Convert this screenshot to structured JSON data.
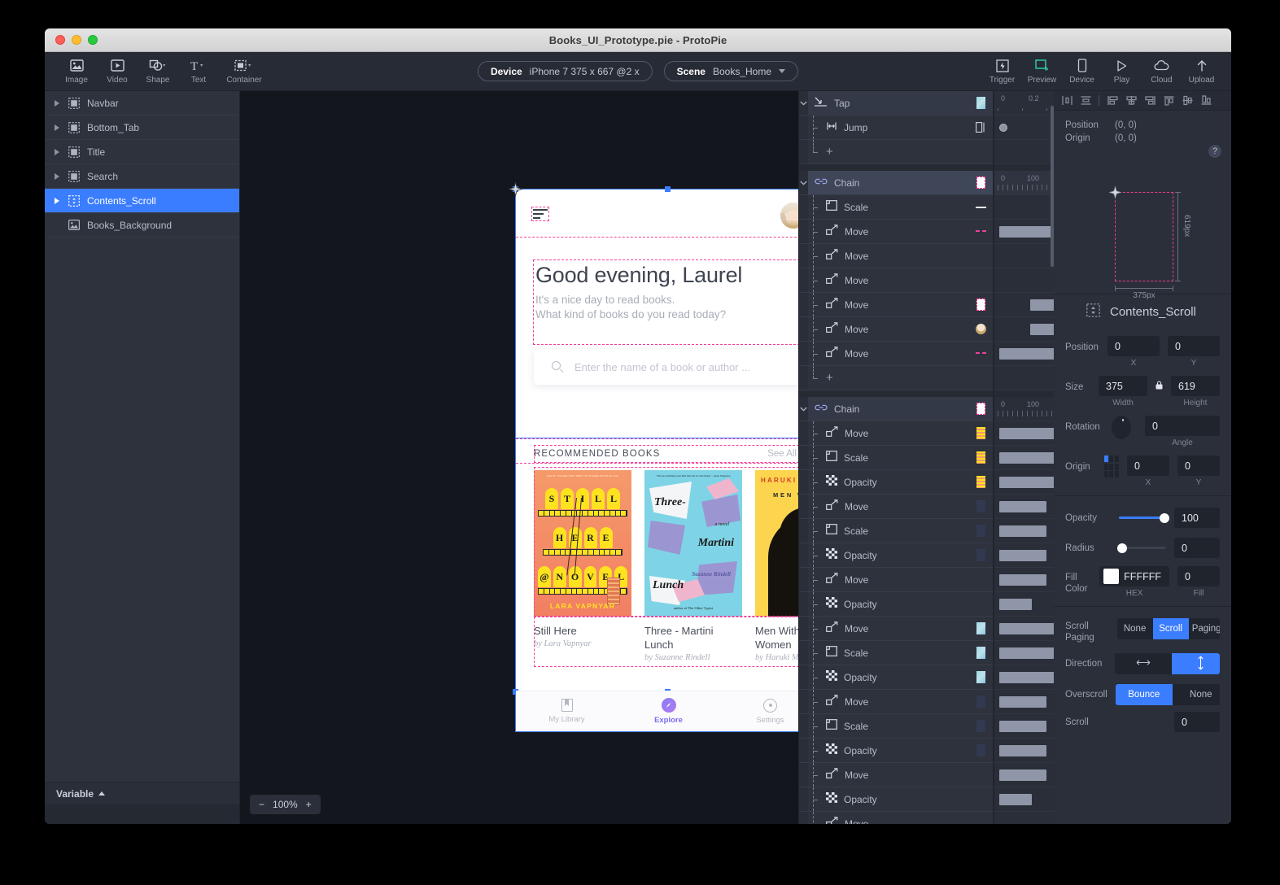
{
  "window": {
    "title": "Books_UI_Prototype.pie - ProtoPie"
  },
  "toolbar": {
    "left_tools": [
      {
        "label": "Image",
        "icon": "image-icon",
        "has_caret": false
      },
      {
        "label": "Video",
        "icon": "video-icon",
        "has_caret": false
      },
      {
        "label": "Shape",
        "icon": "shape-icon",
        "has_caret": true
      },
      {
        "label": "Text",
        "icon": "text-icon",
        "has_caret": true
      },
      {
        "label": "Container",
        "icon": "container-icon",
        "has_caret": true
      }
    ],
    "device": {
      "key": "Device",
      "value": "iPhone 7  375 x 667  @2 x"
    },
    "scene": {
      "key": "Scene",
      "value": "Books_Home"
    },
    "right_tools": [
      {
        "label": "Trigger",
        "icon": "trigger-icon"
      },
      {
        "label": "Preview",
        "icon": "preview-icon"
      },
      {
        "label": "Device",
        "icon": "device-icon"
      },
      {
        "label": "Play",
        "icon": "play-icon"
      },
      {
        "label": "Cloud",
        "icon": "cloud-icon"
      },
      {
        "label": "Upload",
        "icon": "upload-icon"
      }
    ]
  },
  "layers": {
    "items": [
      {
        "name": "Navbar",
        "icon": "container-icon",
        "selected": false,
        "expandable": true
      },
      {
        "name": "Bottom_Tab",
        "icon": "container-icon",
        "selected": false,
        "expandable": true
      },
      {
        "name": "Title",
        "icon": "container-icon",
        "selected": false,
        "expandable": true
      },
      {
        "name": "Search",
        "icon": "container-icon",
        "selected": false,
        "expandable": true
      },
      {
        "name": "Contents_Scroll",
        "icon": "scroll-container-icon",
        "selected": true,
        "expandable": true
      },
      {
        "name": "Books_Background",
        "icon": "image-icon",
        "selected": false,
        "expandable": false
      }
    ],
    "variable_label": "Variable"
  },
  "canvas": {
    "zoom_level": "100%",
    "zoom_out": "−",
    "zoom_in": "+",
    "phone": {
      "greeting": "Good evening, Laurel",
      "subtitle_line1": "It's a nice day to read books.",
      "subtitle_line2": "What kind of books do you read today?",
      "search_placeholder": "Enter the name of a book or author ...",
      "section_title": "RECOMMENDED BOOKS",
      "see_all": "See All",
      "books": [
        {
          "title": "Still Here",
          "author": "by Lara Vapnyar",
          "cover_top_text": "ONE OF THE NEW YORK TIMES 100 NOTABLE BOOKS OF 2016",
          "cover_words": [
            "S",
            "T",
            "I",
            "L",
            "L",
            "H",
            "E",
            "R",
            "E",
            "@",
            "N",
            "O",
            "V",
            "E",
            "L"
          ],
          "cover_author": "LARA VAPNYAR"
        },
        {
          "title": "Three - Martini Lunch",
          "author": "by Suzanne Rindell",
          "cover_blurb": "\"Here he publishing what Mad Men did for advertising.\" - James Magnuson",
          "cover_t1": "Three-",
          "cover_t2": "a novel",
          "cover_t3": "Martini",
          "cover_t4": "Lunch",
          "cover_t5": "Suzanne Rindell",
          "cover_t6": "author of The Other Typist"
        },
        {
          "title": "Men Without Women",
          "author": "by Haruki Mura",
          "cover_t1": "HARUKI MUR",
          "cover_t2": "MEN W"
        }
      ],
      "tabs": [
        {
          "label": "My Library",
          "icon": "bookmark-icon",
          "active": false
        },
        {
          "label": "Explore",
          "icon": "compass-icon",
          "active": true
        },
        {
          "label": "Settings",
          "icon": "gear-icon",
          "active": false
        }
      ]
    }
  },
  "timeline": {
    "groups": [
      {
        "name": "Tap",
        "icon": "tap-icon",
        "thumb": "photo",
        "selected": false,
        "ruler": {
          "start": "0",
          "mid": "0.2"
        },
        "rows": [
          {
            "name": "Jump",
            "icon": "jump-icon",
            "thumb": "jump-thumb",
            "track": "keyframe"
          },
          {
            "name": "+",
            "icon": "plus-icon",
            "thumb": "",
            "track": ""
          }
        ]
      },
      {
        "name": "Chain",
        "icon": "chain-icon",
        "thumb": "dash",
        "selected": true,
        "ruler": {
          "start": "0",
          "mid": "100"
        },
        "rows": [
          {
            "name": "Scale",
            "icon": "scale-icon",
            "thumb": "line",
            "track": ""
          },
          {
            "name": "Move",
            "icon": "move-icon",
            "thumb": "pinkline",
            "track": "bar-long"
          },
          {
            "name": "Move",
            "icon": "move-icon",
            "thumb": "empty",
            "track": ""
          },
          {
            "name": "Move",
            "icon": "move-icon",
            "thumb": "empty",
            "track": ""
          },
          {
            "name": "Move",
            "icon": "move-icon",
            "thumb": "dash",
            "track": "bar-short"
          },
          {
            "name": "Move",
            "icon": "move-icon",
            "thumb": "face",
            "track": "bar-short"
          },
          {
            "name": "Move",
            "icon": "move-icon",
            "thumb": "pinkline",
            "track": "bar-long"
          },
          {
            "name": "+",
            "icon": "plus-icon",
            "thumb": "",
            "track": ""
          }
        ]
      },
      {
        "name": "Chain",
        "icon": "chain-icon",
        "thumb": "dash",
        "selected": false,
        "ruler": {
          "start": "0",
          "mid": "100"
        },
        "rows": [
          {
            "name": "Move",
            "icon": "move-icon",
            "thumb": "book1",
            "track": "bar-long"
          },
          {
            "name": "Scale",
            "icon": "scale-icon",
            "thumb": "book1",
            "track": "bar-long"
          },
          {
            "name": "Opacity",
            "icon": "opacity-icon",
            "thumb": "book1",
            "track": "bar-long"
          },
          {
            "name": "Move",
            "icon": "move-icon",
            "thumb": "bluebox",
            "track": "bar-med"
          },
          {
            "name": "Scale",
            "icon": "scale-icon",
            "thumb": "bluebox",
            "track": "bar-med"
          },
          {
            "name": "Opacity",
            "icon": "opacity-icon",
            "thumb": "bluebox",
            "track": "bar-med"
          },
          {
            "name": "Move",
            "icon": "move-icon",
            "thumb": "empty",
            "track": "bar-med"
          },
          {
            "name": "Opacity",
            "icon": "opacity-icon",
            "thumb": "empty",
            "track": "bar-sm"
          },
          {
            "name": "Move",
            "icon": "move-icon",
            "thumb": "photo",
            "track": "bar-long"
          },
          {
            "name": "Scale",
            "icon": "scale-icon",
            "thumb": "photo",
            "track": "bar-long"
          },
          {
            "name": "Opacity",
            "icon": "opacity-icon",
            "thumb": "photo",
            "track": "bar-long"
          },
          {
            "name": "Move",
            "icon": "move-icon",
            "thumb": "bluebox",
            "track": "bar-med"
          },
          {
            "name": "Scale",
            "icon": "scale-icon",
            "thumb": "bluebox",
            "track": "bar-med"
          },
          {
            "name": "Opacity",
            "icon": "opacity-icon",
            "thumb": "bluebox",
            "track": "bar-med"
          },
          {
            "name": "Move",
            "icon": "move-icon",
            "thumb": "empty",
            "track": "bar-med"
          },
          {
            "name": "Opacity",
            "icon": "opacity-icon",
            "thumb": "empty",
            "track": "bar-sm"
          },
          {
            "name": "Move",
            "icon": "move-icon",
            "thumb": "empty",
            "track": ""
          }
        ]
      }
    ]
  },
  "properties": {
    "geometry_preview": {
      "position_label": "Position",
      "position_value": "(0, 0)",
      "origin_label": "Origin",
      "origin_value": "(0, 0)",
      "help": "?",
      "width_label": "375px",
      "height_label": "619px"
    },
    "object_name": "Contents_Scroll",
    "position": {
      "label": "Position",
      "x": "0",
      "y": "0",
      "x_sub": "X",
      "y_sub": "Y"
    },
    "size": {
      "label": "Size",
      "width": "375",
      "height": "619",
      "width_sub": "Width",
      "height_sub": "Height"
    },
    "rotation": {
      "label": "Rotation",
      "angle": "0",
      "angle_sub": "Angle"
    },
    "origin": {
      "label": "Origin",
      "x": "0",
      "y": "0",
      "x_sub": "X",
      "y_sub": "Y"
    },
    "opacity": {
      "label": "Opacity",
      "value": "100",
      "percent": 100
    },
    "radius": {
      "label": "Radius",
      "value": "0",
      "percent": 0
    },
    "fill_color": {
      "label": "Fill Color",
      "hex": "FFFFFF",
      "fill": "0",
      "hex_sub": "HEX",
      "fill_sub": "Fill",
      "swatch": "#FFFFFF"
    },
    "scroll_paging": {
      "label": "Scroll Paging",
      "options": [
        "None",
        "Scroll",
        "Paging"
      ],
      "selected": "Scroll"
    },
    "direction": {
      "label": "Direction",
      "options": [
        "horizontal",
        "vertical"
      ],
      "selected": "vertical"
    },
    "overscroll": {
      "label": "Overscroll",
      "options": [
        "Bounce",
        "None"
      ],
      "selected": "Bounce"
    },
    "scroll": {
      "label": "Scroll",
      "value": "0"
    }
  },
  "colors": {
    "accent": "#3B7DFF",
    "guide_pink": "#F0409A",
    "panel_bg": "#2B2F3A",
    "canvas_bg": "#14161D"
  }
}
